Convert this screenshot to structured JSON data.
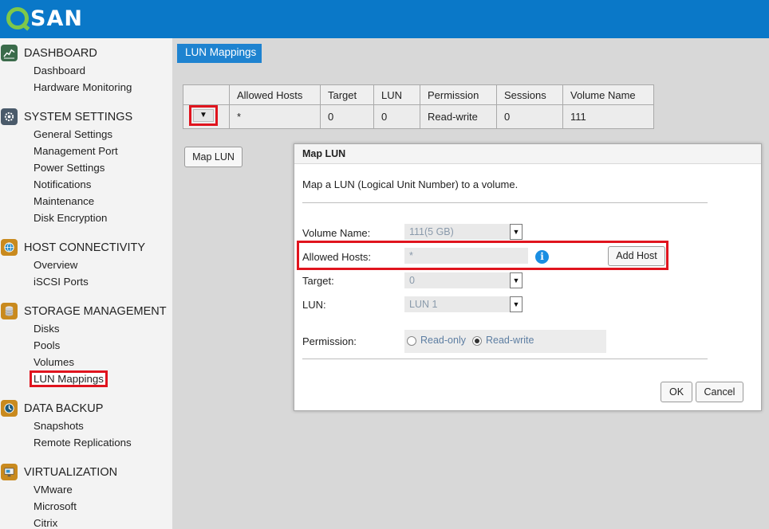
{
  "brand": {
    "logo_text": "SAN",
    "logo_color": "#7ec84a",
    "bar_color": "#0a78c8"
  },
  "sidebar": [
    {
      "title": "DASHBOARD",
      "icon": "dashboard-chart-icon",
      "items": [
        "Dashboard",
        "Hardware Monitoring"
      ]
    },
    {
      "title": "SYSTEM SETTINGS",
      "icon": "settings-gear-icon",
      "items": [
        "General Settings",
        "Management Port",
        "Power Settings",
        "Notifications",
        "Maintenance",
        "Disk Encryption"
      ]
    },
    {
      "title": "HOST CONNECTIVITY",
      "icon": "globe-icon",
      "items": [
        "Overview",
        "iSCSI Ports"
      ]
    },
    {
      "title": "STORAGE MANAGEMENT",
      "icon": "database-icon",
      "items": [
        "Disks",
        "Pools",
        "Volumes",
        "LUN Mappings"
      ]
    },
    {
      "title": "DATA BACKUP",
      "icon": "backup-clock-icon",
      "items": [
        "Snapshots",
        "Remote Replications"
      ]
    },
    {
      "title": "VIRTUALIZATION",
      "icon": "virtualization-icon",
      "items": [
        "VMware",
        "Microsoft",
        "Citrix"
      ]
    }
  ],
  "active_item": "LUN Mappings",
  "page_tab": "LUN Mappings",
  "table": {
    "headers": [
      "",
      "Allowed Hosts",
      "Target",
      "LUN",
      "Permission",
      "Sessions",
      "Volume Name"
    ],
    "rows": [
      {
        "action_glyph": "▼",
        "cells": [
          "*",
          "0",
          "0",
          "Read-write",
          "0",
          "111"
        ]
      }
    ]
  },
  "map_lun_button": "Map LUN",
  "dialog": {
    "title": "Map LUN",
    "description": "Map a LUN (Logical Unit Number) to a volume.",
    "volume_label": "Volume Name:",
    "volume_value": "111(5 GB)",
    "hosts_label": "Allowed Hosts:",
    "hosts_value": "*",
    "add_host_label": "Add Host",
    "target_label": "Target:",
    "target_value": "0",
    "lun_label": "LUN:",
    "lun_value": "LUN 1",
    "permission_label": "Permission:",
    "permission_options": [
      "Read-only",
      "Read-write"
    ],
    "permission_selected": "Read-write",
    "ok_label": "OK",
    "cancel_label": "Cancel"
  },
  "highlight_color": "#e0141e"
}
